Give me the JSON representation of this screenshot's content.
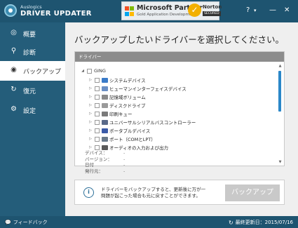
{
  "brand": {
    "small": "Auslogics",
    "big": "DRIVER UPDATER"
  },
  "partner": {
    "name": "Microsoft Partner",
    "sub": "Gold Application Development"
  },
  "norton": {
    "name": "Norton",
    "sub": "SECURED"
  },
  "window": {
    "help": "?",
    "menu": "▾",
    "minimize": "—",
    "close": "✕"
  },
  "sidebar": {
    "items": [
      {
        "label": "概要",
        "icon": "target-icon",
        "glyph": "◎"
      },
      {
        "label": "診断",
        "icon": "search-icon",
        "glyph": "🔍"
      },
      {
        "label": "バックアップ",
        "icon": "backup-disc-icon",
        "glyph": "◉"
      },
      {
        "label": "復元",
        "icon": "restore-icon",
        "glyph": "↻"
      },
      {
        "label": "設定",
        "icon": "gear-icon",
        "glyph": "⚙"
      }
    ]
  },
  "main": {
    "heading": "バックアップしたいドライバーを選択してください。",
    "device_header": "ドライバー",
    "root": "GING",
    "tree": [
      {
        "label": "システムデバイス",
        "color": "#3a7bc8"
      },
      {
        "label": "ヒューマンインターフェイスデバイス",
        "color": "#6a8fc4"
      },
      {
        "label": "記憶域ボリューム",
        "color": "#8a8a8a"
      },
      {
        "label": "ディスクドライブ",
        "color": "#9a9a9a"
      },
      {
        "label": "印刷キュー",
        "color": "#7a7a7a"
      },
      {
        "label": "ユニバーサルシリアルバスコントローラー",
        "color": "#5a6a8a"
      },
      {
        "label": "ポータブルデバイス",
        "color": "#3a5aa8"
      },
      {
        "label": "ポート（COMとLPT）",
        "color": "#6a7a8a"
      },
      {
        "label": "オーディオの入力および出力",
        "color": "#5a5a5a"
      }
    ],
    "info": [
      {
        "label": "デバイス：",
        "value": "-"
      },
      {
        "label": "バージョン：",
        "value": "-"
      },
      {
        "label": "日付",
        "value": "-"
      },
      {
        "label": "発行元：",
        "value": "-"
      }
    ],
    "notice": "ドライバーをバックアップすると、更新後に万が一問題が起こった場合も元に戻すことができます。",
    "backup_button": "バックアップ"
  },
  "status": {
    "feedback": "フィードバック",
    "last_update": "最終更新日：2015/07/16"
  },
  "colors": {
    "titlebar": "#1e5470",
    "sidebar": "#245d7a",
    "scroll_thumb": "#2b87c8"
  }
}
